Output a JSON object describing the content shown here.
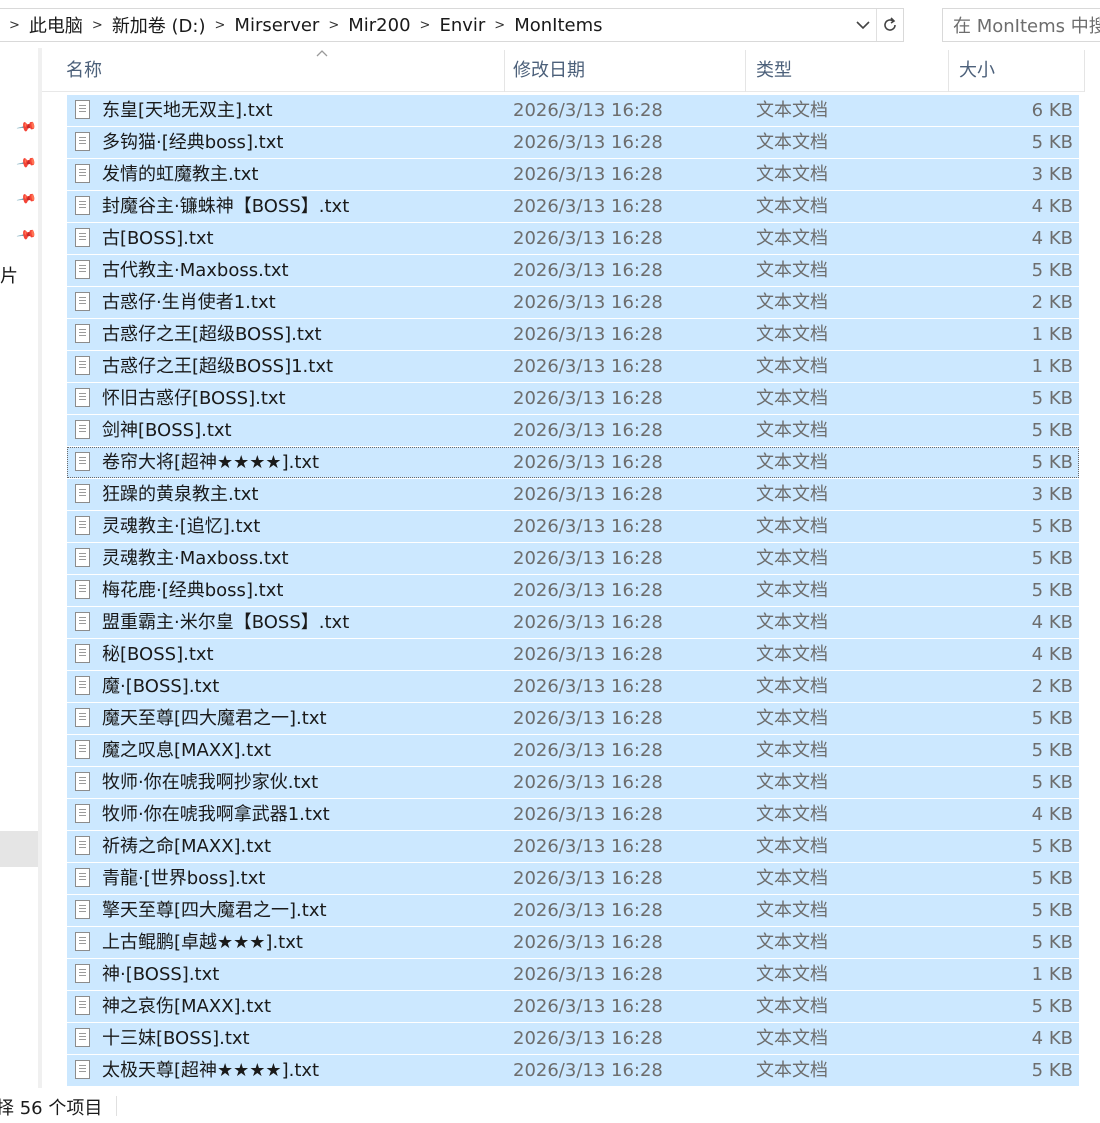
{
  "address": {
    "crumbs": [
      "此电脑",
      "新加卷 (D:)",
      "Mirserver",
      "Mir200",
      "Envir",
      "MonItems"
    ],
    "separator": ">",
    "dropdown_icon": "chevron-down-icon",
    "refresh_icon": "refresh-icon"
  },
  "search": {
    "placeholder": "在 MonItems 中搜"
  },
  "nav": {
    "partial_label": "照片"
  },
  "columns": {
    "name": "名称",
    "date": "修改日期",
    "type": "类型",
    "size": "大小"
  },
  "files": [
    {
      "name": "东皇[天地无双主].txt",
      "date": "2026/3/13 16:28",
      "type": "文本文档",
      "size": "6 KB"
    },
    {
      "name": "多钩猫·[经典boss].txt",
      "date": "2026/3/13 16:28",
      "type": "文本文档",
      "size": "5 KB"
    },
    {
      "name": "发情的虹魔教主.txt",
      "date": "2026/3/13 16:28",
      "type": "文本文档",
      "size": "3 KB"
    },
    {
      "name": "封魔谷主·镰蛛神【BOSS】.txt",
      "date": "2026/3/13 16:28",
      "type": "文本文档",
      "size": "4 KB"
    },
    {
      "name": "古[BOSS].txt",
      "date": "2026/3/13 16:28",
      "type": "文本文档",
      "size": "4 KB"
    },
    {
      "name": "古代教主·Maxboss.txt",
      "date": "2026/3/13 16:28",
      "type": "文本文档",
      "size": "5 KB"
    },
    {
      "name": "古惑仔·生肖使者1.txt",
      "date": "2026/3/13 16:28",
      "type": "文本文档",
      "size": "2 KB"
    },
    {
      "name": "古惑仔之王[超级BOSS].txt",
      "date": "2026/3/13 16:28",
      "type": "文本文档",
      "size": "1 KB"
    },
    {
      "name": "古惑仔之王[超级BOSS]1.txt",
      "date": "2026/3/13 16:28",
      "type": "文本文档",
      "size": "1 KB"
    },
    {
      "name": "怀旧古惑仔[BOSS].txt",
      "date": "2026/3/13 16:28",
      "type": "文本文档",
      "size": "5 KB"
    },
    {
      "name": "剑神[BOSS].txt",
      "date": "2026/3/13 16:28",
      "type": "文本文档",
      "size": "5 KB"
    },
    {
      "name": "卷帘大将[超神★★★★].txt",
      "date": "2026/3/13 16:28",
      "type": "文本文档",
      "size": "5 KB",
      "focus": true
    },
    {
      "name": "狂躁的黄泉教主.txt",
      "date": "2026/3/13 16:28",
      "type": "文本文档",
      "size": "3 KB"
    },
    {
      "name": "灵魂教主·[追忆].txt",
      "date": "2026/3/13 16:28",
      "type": "文本文档",
      "size": "5 KB"
    },
    {
      "name": "灵魂教主·Maxboss.txt",
      "date": "2026/3/13 16:28",
      "type": "文本文档",
      "size": "5 KB"
    },
    {
      "name": "梅花鹿·[经典boss].txt",
      "date": "2026/3/13 16:28",
      "type": "文本文档",
      "size": "5 KB"
    },
    {
      "name": "盟重霸主·米尔皇【BOSS】.txt",
      "date": "2026/3/13 16:28",
      "type": "文本文档",
      "size": "4 KB"
    },
    {
      "name": "秘[BOSS].txt",
      "date": "2026/3/13 16:28",
      "type": "文本文档",
      "size": "4 KB"
    },
    {
      "name": "魔·[BOSS].txt",
      "date": "2026/3/13 16:28",
      "type": "文本文档",
      "size": "2 KB"
    },
    {
      "name": "魔天至尊[四大魔君之一].txt",
      "date": "2026/3/13 16:28",
      "type": "文本文档",
      "size": "5 KB"
    },
    {
      "name": "魔之叹息[MAXX].txt",
      "date": "2026/3/13 16:28",
      "type": "文本文档",
      "size": "5 KB"
    },
    {
      "name": "牧师·你在唬我啊抄家伙.txt",
      "date": "2026/3/13 16:28",
      "type": "文本文档",
      "size": "5 KB"
    },
    {
      "name": "牧师·你在唬我啊拿武器1.txt",
      "date": "2026/3/13 16:28",
      "type": "文本文档",
      "size": "4 KB"
    },
    {
      "name": "祈祷之命[MAXX].txt",
      "date": "2026/3/13 16:28",
      "type": "文本文档",
      "size": "5 KB"
    },
    {
      "name": "青龍·[世界boss].txt",
      "date": "2026/3/13 16:28",
      "type": "文本文档",
      "size": "5 KB"
    },
    {
      "name": "擎天至尊[四大魔君之一].txt",
      "date": "2026/3/13 16:28",
      "type": "文本文档",
      "size": "5 KB"
    },
    {
      "name": "上古鲲鹏[卓越★★★].txt",
      "date": "2026/3/13 16:28",
      "type": "文本文档",
      "size": "5 KB"
    },
    {
      "name": "神·[BOSS].txt",
      "date": "2026/3/13 16:28",
      "type": "文本文档",
      "size": "1 KB"
    },
    {
      "name": "神之哀伤[MAXX].txt",
      "date": "2026/3/13 16:28",
      "type": "文本文档",
      "size": "5 KB"
    },
    {
      "name": "十三妹[BOSS].txt",
      "date": "2026/3/13 16:28",
      "type": "文本文档",
      "size": "4 KB"
    },
    {
      "name": "太极天尊[超神★★★★].txt",
      "date": "2026/3/13 16:28",
      "type": "文本文档",
      "size": "5 KB"
    }
  ],
  "status": {
    "text": "择 56 个项目"
  },
  "colors": {
    "selection": "#cce8ff",
    "header_text": "#4c607a",
    "secondary_text": "#6d6d6d"
  }
}
